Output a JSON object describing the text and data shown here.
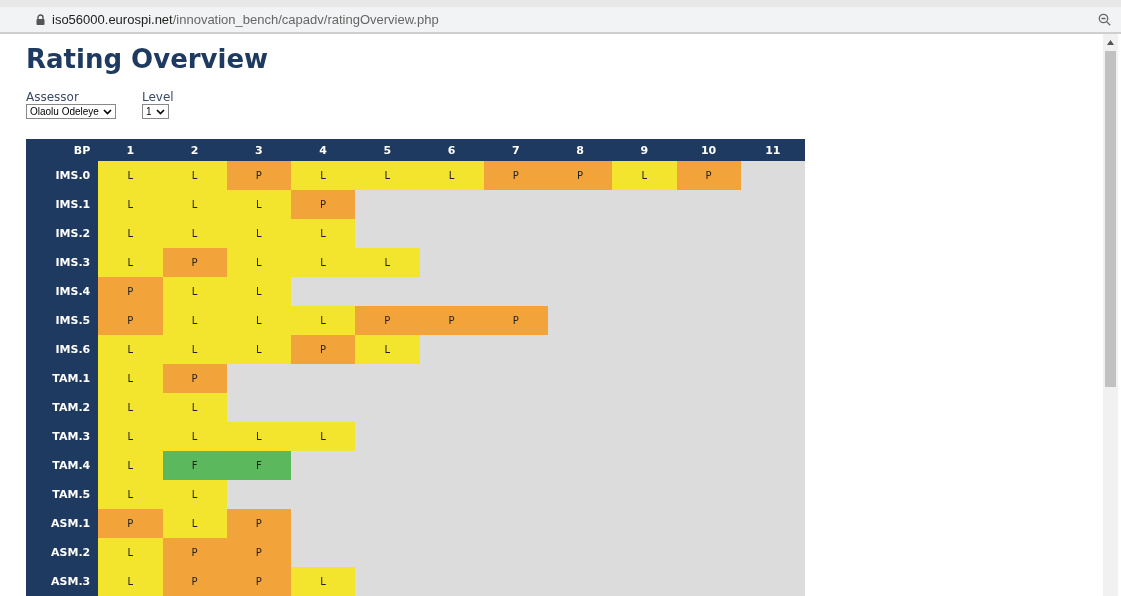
{
  "address_bar": {
    "url_host": "iso56000.eurospi.net",
    "url_path": "/innovation_bench/capadv/ratingOverview.php"
  },
  "title": "Rating Overview",
  "filters": [
    {
      "label": "Assessor",
      "value": "Olaolu Odeleye"
    },
    {
      "label": "Level",
      "value": "1"
    }
  ],
  "table": {
    "corner": "BP",
    "columns": [
      "1",
      "2",
      "3",
      "4",
      "5",
      "6",
      "7",
      "8",
      "9",
      "10",
      "11"
    ],
    "rows": [
      {
        "name": "IMS.0",
        "cells": [
          {
            "text": "L",
            "kind": "largely"
          },
          {
            "text": "L",
            "kind": "largely"
          },
          {
            "text": "P",
            "kind": "partly"
          },
          {
            "text": "L",
            "kind": "largely"
          },
          {
            "text": "L",
            "kind": "largely"
          },
          {
            "text": "L",
            "kind": "largely"
          },
          {
            "text": "P",
            "kind": "partly"
          },
          {
            "text": "P",
            "kind": "partly"
          },
          {
            "text": "L",
            "kind": "largely"
          },
          {
            "text": "P",
            "kind": "partly"
          }
        ]
      },
      {
        "name": "IMS.1",
        "cells": [
          {
            "text": "L",
            "kind": "largely"
          },
          {
            "text": "L",
            "kind": "largely"
          },
          {
            "text": "L",
            "kind": "largely"
          },
          {
            "text": "P",
            "kind": "partly"
          }
        ]
      },
      {
        "name": "IMS.2",
        "cells": [
          {
            "text": "L",
            "kind": "largely"
          },
          {
            "text": "L",
            "kind": "largely"
          },
          {
            "text": "L",
            "kind": "largely"
          },
          {
            "text": "L",
            "kind": "largely"
          }
        ]
      },
      {
        "name": "IMS.3",
        "cells": [
          {
            "text": "L",
            "kind": "largely"
          },
          {
            "text": "P",
            "kind": "partly"
          },
          {
            "text": "L",
            "kind": "largely"
          },
          {
            "text": "L",
            "kind": "largely"
          },
          {
            "text": "L",
            "kind": "largely"
          }
        ]
      },
      {
        "name": "IMS.4",
        "cells": [
          {
            "text": "P",
            "kind": "partly"
          },
          {
            "text": "L",
            "kind": "largely"
          },
          {
            "text": "L",
            "kind": "largely"
          }
        ]
      },
      {
        "name": "IMS.5",
        "cells": [
          {
            "text": "P",
            "kind": "partly"
          },
          {
            "text": "L",
            "kind": "largely"
          },
          {
            "text": "L",
            "kind": "largely"
          },
          {
            "text": "L",
            "kind": "largely"
          },
          {
            "text": "P",
            "kind": "partly"
          },
          {
            "text": "P",
            "kind": "partly"
          },
          {
            "text": "P",
            "kind": "partly"
          }
        ]
      },
      {
        "name": "IMS.6",
        "cells": [
          {
            "text": "L",
            "kind": "largely"
          },
          {
            "text": "L",
            "kind": "largely"
          },
          {
            "text": "L",
            "kind": "largely"
          },
          {
            "text": "P",
            "kind": "partly"
          },
          {
            "text": "L",
            "kind": "largely"
          }
        ]
      },
      {
        "name": "TAM.1",
        "cells": [
          {
            "text": "L",
            "kind": "largely"
          },
          {
            "text": "P",
            "kind": "partly"
          }
        ]
      },
      {
        "name": "TAM.2",
        "cells": [
          {
            "text": "L",
            "kind": "largely"
          },
          {
            "text": "L",
            "kind": "largely"
          }
        ]
      },
      {
        "name": "TAM.3",
        "cells": [
          {
            "text": "L",
            "kind": "largely"
          },
          {
            "text": "L",
            "kind": "largely"
          },
          {
            "text": "L",
            "kind": "largely"
          },
          {
            "text": "L",
            "kind": "largely"
          }
        ]
      },
      {
        "name": "TAM.4",
        "cells": [
          {
            "text": "L",
            "kind": "largely"
          },
          {
            "text": "F",
            "kind": "fully"
          },
          {
            "text": "F",
            "kind": "fully"
          }
        ]
      },
      {
        "name": "TAM.5",
        "cells": [
          {
            "text": "L",
            "kind": "largely"
          },
          {
            "text": "L",
            "kind": "largely"
          }
        ]
      },
      {
        "name": "ASM.1",
        "cells": [
          {
            "text": "P",
            "kind": "partly"
          },
          {
            "text": "L",
            "kind": "largely"
          },
          {
            "text": "P",
            "kind": "partly"
          }
        ]
      },
      {
        "name": "ASM.2",
        "cells": [
          {
            "text": "L",
            "kind": "largely"
          },
          {
            "text": "P",
            "kind": "partly"
          },
          {
            "text": "P",
            "kind": "partly"
          }
        ]
      },
      {
        "name": "ASM.3",
        "cells": [
          {
            "text": "L",
            "kind": "largely"
          },
          {
            "text": "P",
            "kind": "partly"
          },
          {
            "text": "P",
            "kind": "partly"
          },
          {
            "text": "L",
            "kind": "largely"
          }
        ]
      }
    ]
  }
}
